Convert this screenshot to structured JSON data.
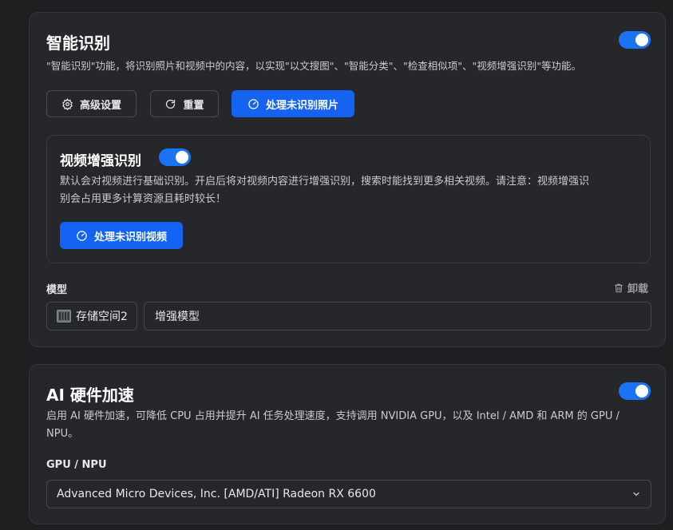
{
  "smart_recognition": {
    "title": "智能识别",
    "enabled": true,
    "description": "\"智能识别\"功能，将识别照片和视频中的内容，以实现\"以文搜图\"、\"智能分类\"、\"检查相似项\"、\"视频增强识别\"等功能。",
    "buttons": {
      "advanced": "高级设置",
      "reset": "重置",
      "process_photos": "处理未识别照片"
    },
    "video_enhanced": {
      "title": "视频增强识别",
      "enabled": true,
      "description_line1": "默认会对视频进行基础识别。开启后将对视频内容进行增强识别，搜索时能找到更多相关视频。请注意：视频增强识",
      "description_line2": "别会占用更多计算资源且耗时较长！",
      "process_button": "处理未识别视频"
    },
    "model": {
      "label": "模型",
      "uninstall": "卸载",
      "storage": "存储空间2",
      "model_name": "增强模型"
    }
  },
  "ai_hardware": {
    "title": "AI 硬件加速",
    "enabled": true,
    "description_line1": "启用 AI 硬件加速，可降低 CPU 占用并提升 AI 任务处理速度，支持调用 NVIDIA GPU，以及 Intel / AMD 和 ARM 的 GPU /",
    "description_line2": "NPU。",
    "gpu_label": "GPU / NPU",
    "gpu_selected": "Advanced Micro Devices, Inc. [AMD/ATI] Radeon RX 6600"
  },
  "colors": {
    "accent": "#1463f3",
    "toggle_on": "#1a73f5",
    "background": "#1e1f21",
    "card": "#26272a"
  }
}
